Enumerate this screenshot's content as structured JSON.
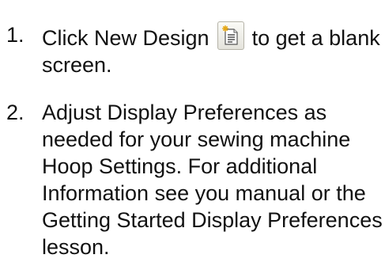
{
  "steps": [
    {
      "number": "1.",
      "text_before": "Click New Design",
      "icon": "new-design-icon",
      "text_after": "to get a blank screen."
    },
    {
      "number": "2.",
      "text": "Adjust Display Preferences as needed for your sewing machine Hoop Settings. For additional Information see you manual or the Getting Started Display Preferences lesson."
    }
  ],
  "colors": {
    "text": "#111111",
    "icon_sparkle": "#e6a817",
    "icon_page": "#ffffff"
  }
}
